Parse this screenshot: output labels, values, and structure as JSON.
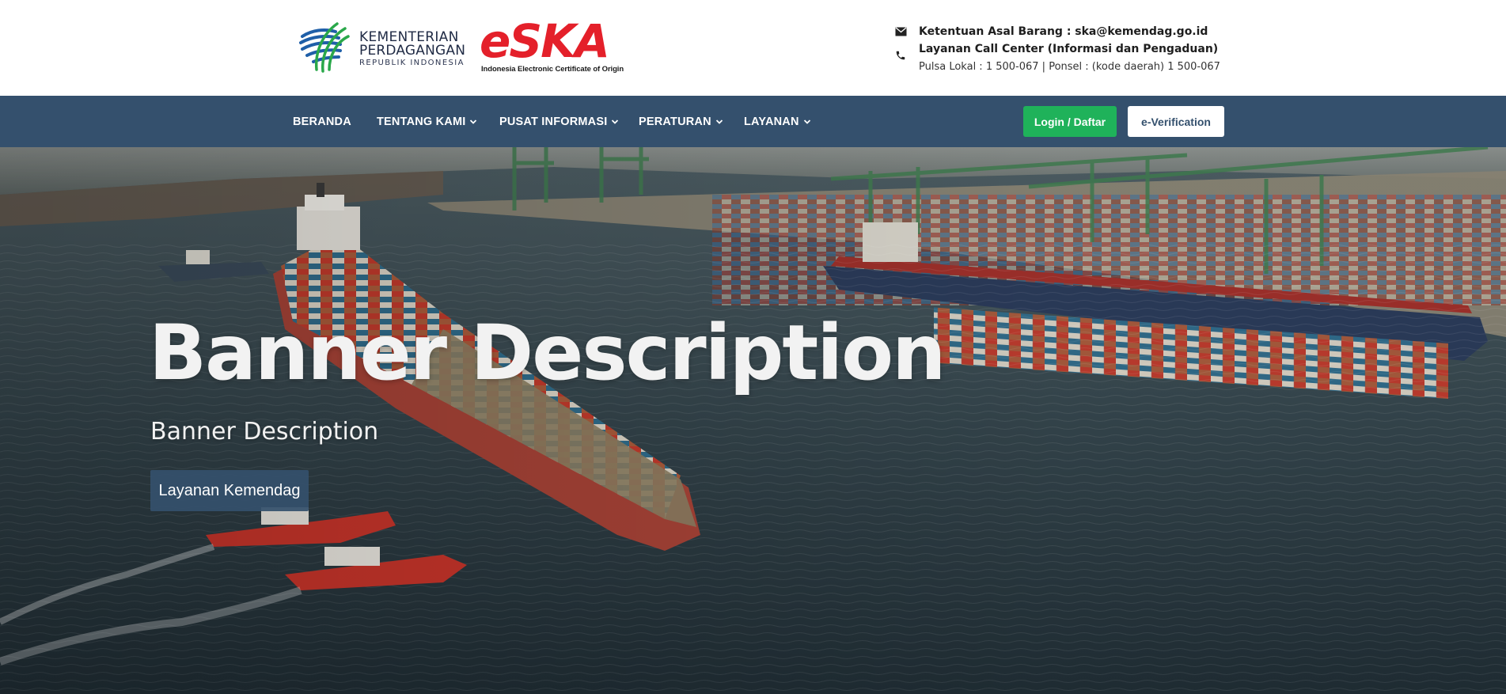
{
  "brand": {
    "ministry_line1": "KEMENTERIAN",
    "ministry_line2": "PERDAGANGAN",
    "ministry_line3": "REPUBLIK INDONESIA",
    "eska_word": "eSKA",
    "eska_tagline": "Indonesia Electronic Certificate of Origin"
  },
  "contact": {
    "email_line": "Ketentuan Asal Barang : ska@kemendag.go.id",
    "callcenter_line": "Layanan Call Center (Informasi dan Pengaduan)",
    "phone_line": "Pulsa Lokal : 1 500-067 | Ponsel : (kode daerah) 1 500-067"
  },
  "nav": {
    "items": [
      {
        "label": "BERANDA",
        "dropdown": false
      },
      {
        "label": "TENTANG KAMI",
        "dropdown": true
      },
      {
        "label": "PUSAT INFORMASI",
        "dropdown": true
      },
      {
        "label": "PERATURAN",
        "dropdown": true
      },
      {
        "label": "LAYANAN",
        "dropdown": true
      }
    ],
    "login_label": "Login / Daftar",
    "verification_label": "e-Verification"
  },
  "hero": {
    "title": "Banner Description",
    "subtitle": "Banner Description",
    "button_label": "Layanan Kemendag"
  },
  "colors": {
    "navbar": "#34506d",
    "login_button": "#1fb25a",
    "eska_red": "#e4202a",
    "hero_button": "#34506d"
  },
  "icons": {
    "email": "envelope-icon",
    "phone": "phone-icon",
    "dropdown": "chevron-down-icon"
  }
}
